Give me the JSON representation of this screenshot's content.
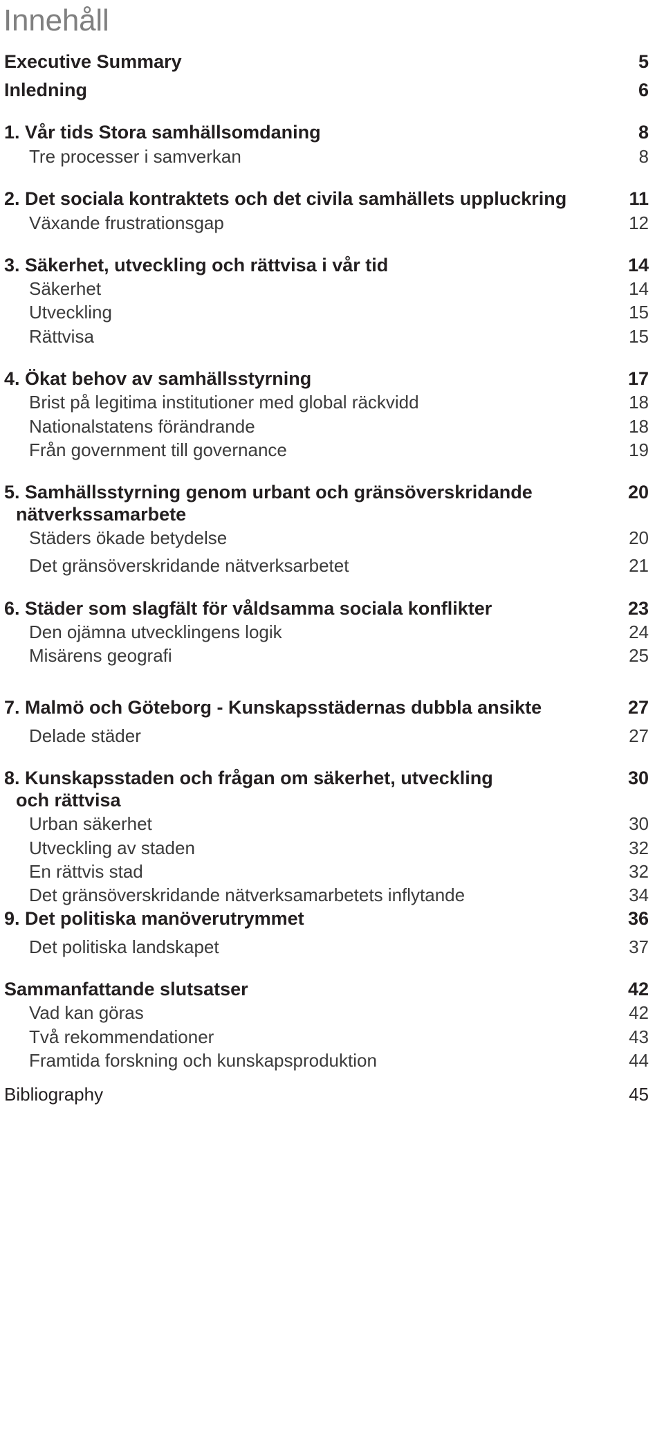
{
  "document": {
    "title": "Innehåll",
    "title_color": "#808080",
    "body_color": "#231f20",
    "sub_color": "#3b3b3b"
  },
  "toc": {
    "entries": [
      {
        "number": "",
        "label": "Executive Summary",
        "page": "5",
        "level": "main",
        "gap": "gap-none"
      },
      {
        "number": "",
        "label": "Inledning",
        "page": "6",
        "level": "main",
        "gap": "gap-sm"
      },
      {
        "number": "1.",
        "label": "Vår tids Stora samhällsomdaning",
        "page": "8",
        "level": "main",
        "gap": "gap-lg"
      },
      {
        "number": "",
        "label": "Tre processer i samverkan",
        "page": "8",
        "level": "sub",
        "gap": "gap-xs"
      },
      {
        "number": "2.",
        "label": "Det sociala kontraktets och det civila samhällets uppluckring",
        "page": "11",
        "level": "main",
        "gap": "gap-lg"
      },
      {
        "number": "",
        "label": "Växande frustrationsgap",
        "page": "12",
        "level": "sub",
        "gap": "gap-xs"
      },
      {
        "number": "3.",
        "label": " Säkerhet, utveckling och rättvisa i vår tid",
        "page": "14",
        "level": "main",
        "gap": "gap-lg"
      },
      {
        "number": "",
        "label": "Säkerhet",
        "page": "14",
        "level": "sub",
        "gap": "gap-xs"
      },
      {
        "number": "",
        "label": "Utveckling",
        "page": "15",
        "level": "sub",
        "gap": "gap-xs"
      },
      {
        "number": "",
        "label": "Rättvisa",
        "page": "15",
        "level": "sub",
        "gap": "gap-xs"
      },
      {
        "number": "4.",
        "label": "Ökat behov av samhällsstyrning",
        "page": "17",
        "level": "main",
        "gap": "gap-lg"
      },
      {
        "number": "",
        "label": "Brist på legitima institutioner med global räckvidd",
        "page": "18",
        "level": "sub",
        "gap": "gap-xs"
      },
      {
        "number": "",
        "label": "Nationalstatens förändrande",
        "page": "18",
        "level": "sub",
        "gap": "gap-xs"
      },
      {
        "number": "",
        "label": "Från government till governance",
        "page": "19",
        "level": "sub",
        "gap": "gap-xs"
      },
      {
        "number": "5.",
        "label": "Samhällsstyrning genom urbant och gränsöverskridande",
        "label_wrap": "nätverkssamarbete",
        "page": "20",
        "level": "main",
        "gap": "gap-lg"
      },
      {
        "number": "",
        "label": "Städers ökade betydelse",
        "page": "20",
        "level": "sub",
        "gap": "gap-xs"
      },
      {
        "number": "",
        "label": "Det gränsöverskridande nätverksarbetet",
        "page": "21",
        "level": "sub",
        "gap": "gap-sm"
      },
      {
        "number": "6.",
        "label": "Städer som slagfält för våldsamma sociala konflikter",
        "page": "23",
        "level": "main",
        "gap": "gap-lg"
      },
      {
        "number": "",
        "label": "Den ojämna utvecklingens logik",
        "page": "24",
        "level": "sub",
        "gap": "gap-xs"
      },
      {
        "number": "",
        "label": "Misärens geografi",
        "page": "25",
        "level": "sub",
        "gap": "gap-xs"
      },
      {
        "number": "7.",
        "label": "Malmö och Göteborg - Kunskapsstädernas dubbla ansikte",
        "page": "27",
        "level": "main",
        "gap": "gap-xl"
      },
      {
        "number": "",
        "label": "Delade städer",
        "page": "27",
        "level": "sub",
        "gap": "gap-sm"
      },
      {
        "number": "8.",
        "label": "Kunskapsstaden och frågan om säkerhet, utveckling",
        "label_wrap": "och rättvisa",
        "page": "30",
        "level": "main",
        "gap": "gap-lg"
      },
      {
        "number": "",
        "label": "Urban säkerhet",
        "page": "30",
        "level": "sub",
        "gap": "gap-xs"
      },
      {
        "number": "",
        "label": "Utveckling av staden",
        "page": "32",
        "level": "sub",
        "gap": "gap-xs"
      },
      {
        "number": "",
        "label": "En rättvis stad",
        "page": "32",
        "level": "sub",
        "gap": "gap-xs"
      },
      {
        "number": "",
        "label": "Det gränsöverskridande nätverksamarbetets inflytande",
        "page": "34",
        "level": "sub",
        "gap": "gap-xs"
      },
      {
        "number": "9.",
        "label": "Det politiska manöverutrymmet",
        "page": "36",
        "level": "main",
        "gap": "gap-xs"
      },
      {
        "number": "",
        "label": "Det politiska landskapet",
        "page": "37",
        "level": "sub",
        "gap": "gap-sm"
      },
      {
        "number": "",
        "label": "Sammanfattande slutsatser",
        "page": "42",
        "level": "main",
        "gap": "gap-lg"
      },
      {
        "number": "",
        "label": "Vad kan göras",
        "page": "42",
        "level": "sub",
        "gap": "gap-xs"
      },
      {
        "number": "",
        "label": "Två rekommendationer",
        "page": "43",
        "level": "sub",
        "gap": "gap-xs"
      },
      {
        "number": "",
        "label": "Framtida forskning och kunskapsproduktion",
        "page": "44",
        "level": "sub",
        "gap": "gap-xs"
      },
      {
        "number": "",
        "label": "Bibliography",
        "page": "45",
        "level": "plain",
        "gap": "gap-md"
      }
    ]
  }
}
